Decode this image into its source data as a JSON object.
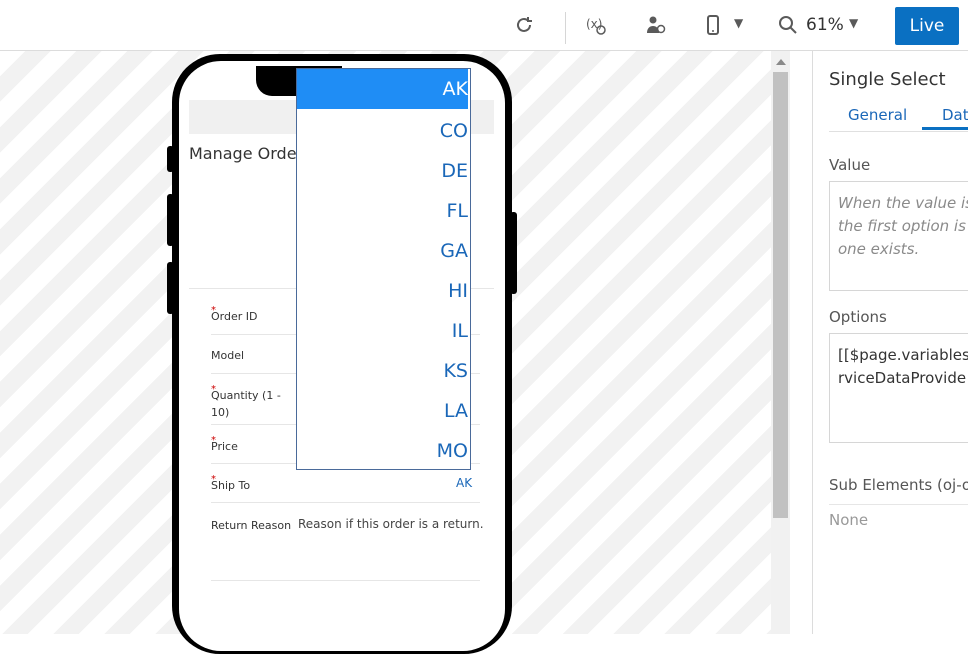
{
  "toolbar": {
    "icons": [
      "refresh-icon",
      "variables-icon",
      "user-role-icon",
      "phone-device-icon",
      "search-icon"
    ],
    "zoom": "61%",
    "live_label": "Live"
  },
  "phone_page": {
    "title": "Manage Orde",
    "fields": [
      {
        "label": "Order ID",
        "required": true
      },
      {
        "label": "Model",
        "required": false
      },
      {
        "label": "Quantity (1 - 10)",
        "required": true
      },
      {
        "label": "Price",
        "required": true
      },
      {
        "label": "Ship To",
        "required": true
      },
      {
        "label": "Return Reason",
        "required": false
      }
    ],
    "ship_to_value": "AK",
    "return_reason_value": "Reason if this order is a return."
  },
  "dropdown": {
    "options": [
      "AK",
      "CO",
      "DE",
      "FL",
      "GA",
      "HI",
      "IL",
      "KS",
      "LA",
      "MO"
    ],
    "selected": "AK"
  },
  "panel": {
    "title": "Single Select",
    "tabs": [
      "General",
      "Data"
    ],
    "active_tab": "Data",
    "value_label": "Value",
    "value_placeholder": "When the value is not set, the first option is used if one exists.",
    "options_label": "Options",
    "options_value": "[[$page.variables.\nrviceDataProvide",
    "sub_elements_label": "Sub Elements (oj-option)",
    "sub_elements_value": "None"
  },
  "colors": {
    "accent": "#0a70c2",
    "selected_option": "#1f8df5",
    "link_text": "#1a67b8"
  }
}
